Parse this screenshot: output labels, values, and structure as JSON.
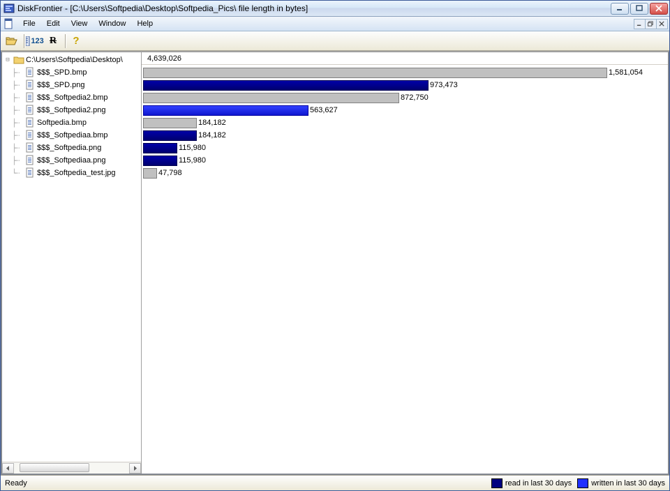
{
  "window": {
    "title": "DiskFrontier - [C:\\Users\\Softpedia\\Desktop\\Softpedia_Pics\\  file length in bytes]"
  },
  "menu": {
    "items": [
      "File",
      "Edit",
      "View",
      "Window",
      "Help"
    ]
  },
  "toolbar": {
    "open": "open-folder",
    "scale": "123",
    "refresh": "R",
    "help": "?"
  },
  "tree": {
    "root": "C:\\Users\\Softpedia\\Desktop\\",
    "files": [
      "$$$_SPD.bmp",
      "$$$_SPD.png",
      "$$$_Softpedia2.bmp",
      "$$$_Softpedia2.png",
      "Softpedia.bmp",
      "$$$_Softpediaa.bmp",
      "$$$_Softpedia.png",
      "$$$_Softpediaa.png",
      "$$$_Softpedia_test.jpg"
    ]
  },
  "status": {
    "ready": "Ready",
    "legend1": "read in last 30 days",
    "legend2": "written in last 30 days"
  },
  "chart_data": {
    "type": "bar",
    "title": "file length in bytes",
    "orientation": "horizontal",
    "xlim": [
      0,
      1581054
    ],
    "total_label": "4,639,026",
    "categories": [
      "$$$_SPD.bmp",
      "$$$_SPD.png",
      "$$$_Softpedia2.bmp",
      "$$$_Softpedia2.png",
      "Softpedia.bmp",
      "$$$_Softpediaa.bmp",
      "$$$_Softpedia.png",
      "$$$_Softpediaa.png",
      "$$$_Softpedia_test.jpg"
    ],
    "values": [
      1581054,
      973473,
      872750,
      563627,
      184182,
      184182,
      115980,
      115980,
      47798
    ],
    "value_labels": [
      "1,581,054",
      "973,473",
      "872,750",
      "563,627",
      "184,182",
      "184,182",
      "115,980",
      "115,980",
      "47,798"
    ],
    "series_style": [
      "gray",
      "navy",
      "gray",
      "blue",
      "gray",
      "navy",
      "navy",
      "navy",
      "gray"
    ],
    "legend": [
      {
        "name": "read in last 30 days",
        "color": "#000080"
      },
      {
        "name": "written in last 30 days",
        "color": "#2030ff"
      }
    ]
  }
}
